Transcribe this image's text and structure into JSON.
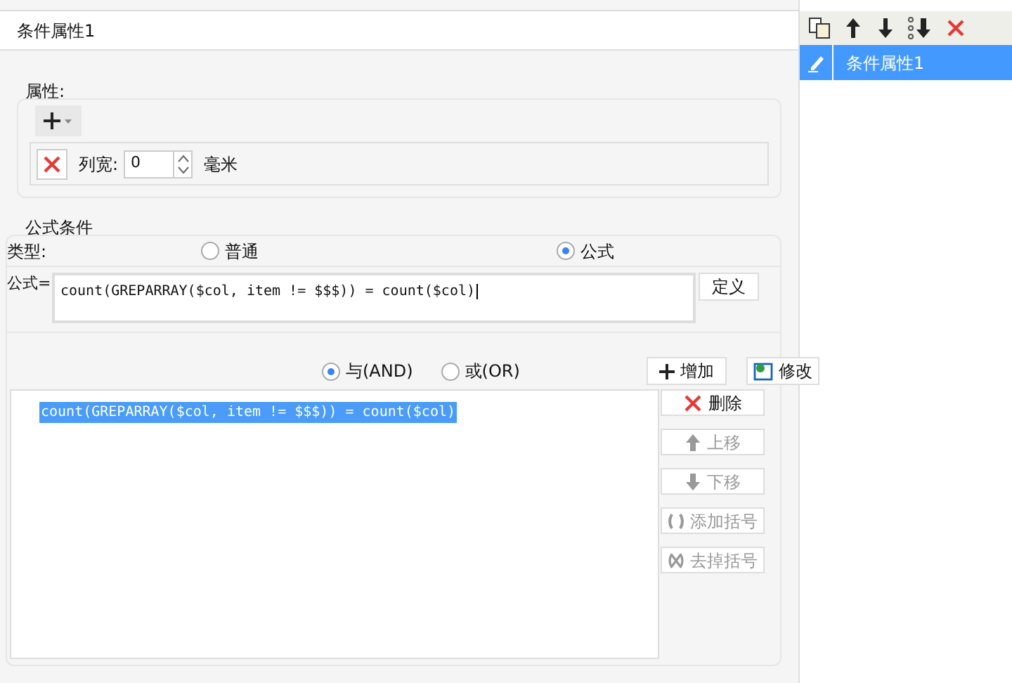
{
  "window": {
    "title": "条件属性1"
  },
  "attributes": {
    "label": "属性:",
    "width_label": "列宽:",
    "width_value": "0",
    "unit": "毫米"
  },
  "formula_condition": {
    "label": "公式条件",
    "type_label": "类型:",
    "types": [
      {
        "label": "普通",
        "selected": false
      },
      {
        "label": "公式",
        "selected": true
      }
    ],
    "formula_label": "公式=",
    "formula_value": "count(GREPARRAY($col, item != $$$)) = count($col)",
    "define_button": "定义",
    "joins": [
      {
        "label": "与(AND)",
        "selected": true
      },
      {
        "label": "或(OR)",
        "selected": false
      }
    ],
    "add_button": "增加",
    "modify_button": "修改",
    "conditions": [
      {
        "text": "count(GREPARRAY($col, item != $$$)) = count($col)",
        "selected": true
      }
    ],
    "actions": [
      {
        "kind": "delete",
        "label": "删除",
        "disabled": false
      },
      {
        "kind": "up",
        "label": "上移",
        "disabled": true
      },
      {
        "kind": "down",
        "label": "下移",
        "disabled": true
      },
      {
        "kind": "add-bracket",
        "label": "添加括号",
        "disabled": true
      },
      {
        "kind": "remove-bracket",
        "label": "去掉括号",
        "disabled": true
      }
    ]
  },
  "side_list": {
    "items": [
      {
        "label": "条件属性1",
        "selected": true
      }
    ]
  }
}
